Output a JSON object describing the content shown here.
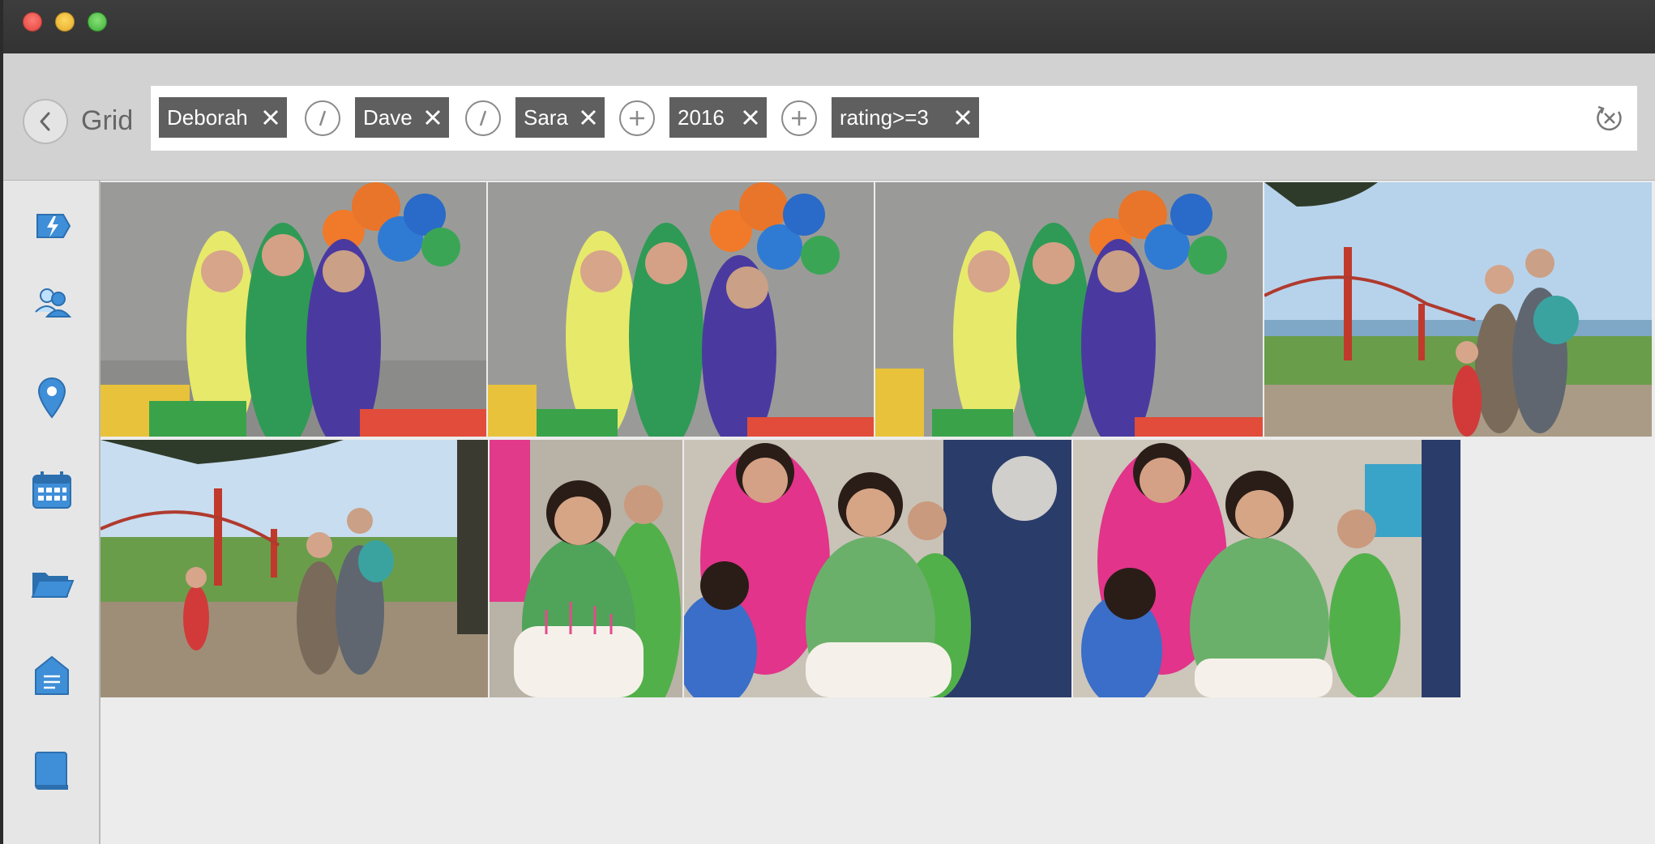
{
  "window": {
    "traffic_lights": [
      "close",
      "minimize",
      "zoom"
    ]
  },
  "toolbar": {
    "title": "Grid",
    "back_icon": "chevron-left-icon",
    "reset_icon": "reset-filter-icon"
  },
  "filters": [
    {
      "label": "Deborah",
      "remove_icon": "close-icon"
    },
    {
      "operator": "or",
      "icon": "slash-icon"
    },
    {
      "label": "Dave",
      "remove_icon": "close-icon"
    },
    {
      "operator": "or",
      "icon": "slash-icon"
    },
    {
      "label": "Sara",
      "remove_icon": "close-icon"
    },
    {
      "operator": "and",
      "icon": "plus-icon"
    },
    {
      "label": "2016",
      "remove_icon": "close-icon"
    },
    {
      "operator": "and",
      "icon": "plus-icon"
    },
    {
      "label": "rating>=3",
      "remove_icon": "close-icon"
    }
  ],
  "sidebar": {
    "items": [
      {
        "name": "quick-icon"
      },
      {
        "name": "people-icon"
      },
      {
        "name": "location-icon"
      },
      {
        "name": "calendar-icon"
      },
      {
        "name": "folder-icon"
      },
      {
        "name": "tag-icon"
      },
      {
        "name": "book-icon"
      }
    ]
  },
  "photos": [
    {
      "subject": "three women with balloons",
      "row": 1
    },
    {
      "subject": "three women with balloons",
      "row": 1
    },
    {
      "subject": "three women with balloons",
      "row": 1
    },
    {
      "subject": "family at golden gate bridge",
      "row": 1
    },
    {
      "subject": "family at golden gate bridge",
      "row": 2
    },
    {
      "subject": "girl with birthday cake",
      "row": 2
    },
    {
      "subject": "girl with birthday cake and family",
      "row": 2
    },
    {
      "subject": "girl with birthday cake and family",
      "row": 2
    }
  ],
  "colors": {
    "accent": "#3f8ed8",
    "chip_bg": "#5f5f5f",
    "titlebar": "#353535"
  }
}
